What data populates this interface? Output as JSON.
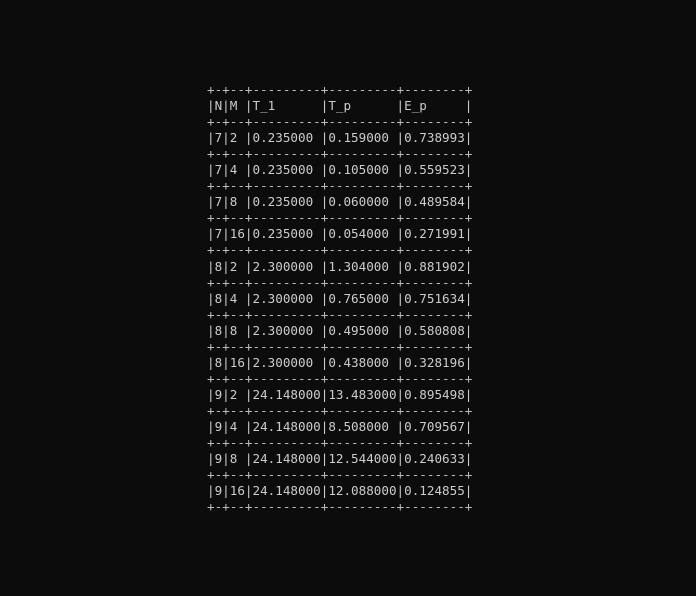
{
  "terminal": {
    "lines": [
      "+-+--+---------+---------+--------+",
      "|N|M |T_1      |T_p      |E_p     |",
      "+-+--+---------+---------+--------+",
      "|7|2 |0.235000 |0.159000 |0.738993|",
      "+-+--+---------+---------+--------+",
      "|7|4 |0.235000 |0.105000 |0.559523|",
      "+-+--+---------+---------+--------+",
      "|7|8 |0.235000 |0.060000 |0.489584|",
      "+-+--+---------+---------+--------+",
      "|7|16|0.235000 |0.054000 |0.271991|",
      "+-+--+---------+---------+--------+",
      "|8|2 |2.300000 |1.304000 |0.881902|",
      "+-+--+---------+---------+--------+",
      "|8|4 |2.300000 |0.765000 |0.751634|",
      "+-+--+---------+---------+--------+",
      "|8|8 |2.300000 |0.495000 |0.580808|",
      "+-+--+---------+---------+--------+",
      "|8|16|2.300000 |0.438000 |0.328196|",
      "+-+--+---------+---------+--------+",
      "|9|2 |24.148000|13.483000|0.895498|",
      "+-+--+---------+---------+--------+",
      "|9|4 |24.148000|8.508000 |0.709567|",
      "+-+--+---------+---------+--------+",
      "|9|8 |24.148000|12.544000|0.240633|",
      "+-+--+---------+---------+--------+",
      "|9|16|24.148000|12.088000|0.124855|",
      "+-+--+---------+---------+--------+"
    ]
  },
  "colors": {
    "background": "#0c0c0c",
    "text": "#cccccc"
  }
}
